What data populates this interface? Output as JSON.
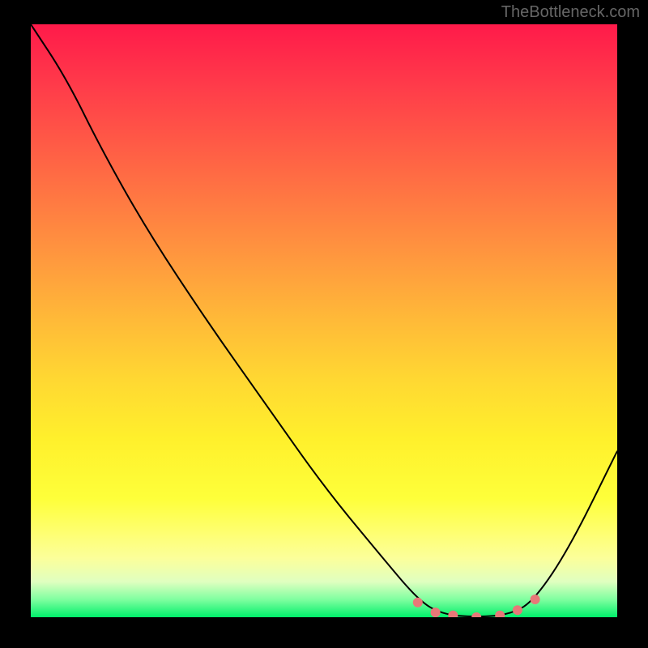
{
  "watermark": "TheBottleneck.com",
  "chart_data": {
    "type": "line",
    "title": "",
    "xlabel": "",
    "ylabel": "",
    "x_range": [
      0,
      100
    ],
    "y_range": [
      0,
      100
    ],
    "curve_points": [
      {
        "x": 0,
        "y": 100
      },
      {
        "x": 6,
        "y": 91
      },
      {
        "x": 12,
        "y": 79
      },
      {
        "x": 20,
        "y": 65
      },
      {
        "x": 30,
        "y": 50
      },
      {
        "x": 40,
        "y": 36
      },
      {
        "x": 50,
        "y": 22
      },
      {
        "x": 60,
        "y": 10
      },
      {
        "x": 66,
        "y": 3
      },
      {
        "x": 70,
        "y": 0.5
      },
      {
        "x": 76,
        "y": 0
      },
      {
        "x": 82,
        "y": 0.5
      },
      {
        "x": 86,
        "y": 3
      },
      {
        "x": 92,
        "y": 12
      },
      {
        "x": 100,
        "y": 28
      }
    ],
    "highlight_zone": {
      "x_start": 66,
      "x_end": 86,
      "marker_positions": [
        {
          "x": 66,
          "y": 2.5
        },
        {
          "x": 69,
          "y": 0.8
        },
        {
          "x": 72,
          "y": 0.3
        },
        {
          "x": 76,
          "y": 0
        },
        {
          "x": 80,
          "y": 0.3
        },
        {
          "x": 83,
          "y": 1.2
        },
        {
          "x": 86,
          "y": 3
        }
      ],
      "marker_color": "#e87878",
      "marker_radius": 6
    },
    "gradient_colors": [
      {
        "stop": 0,
        "color": "#ff1a4a"
      },
      {
        "stop": 0.5,
        "color": "#ffba38"
      },
      {
        "stop": 0.85,
        "color": "#feff6a"
      },
      {
        "stop": 1.0,
        "color": "#00ef6a"
      }
    ],
    "curve_stroke": "#000000",
    "curve_stroke_width": 2
  }
}
